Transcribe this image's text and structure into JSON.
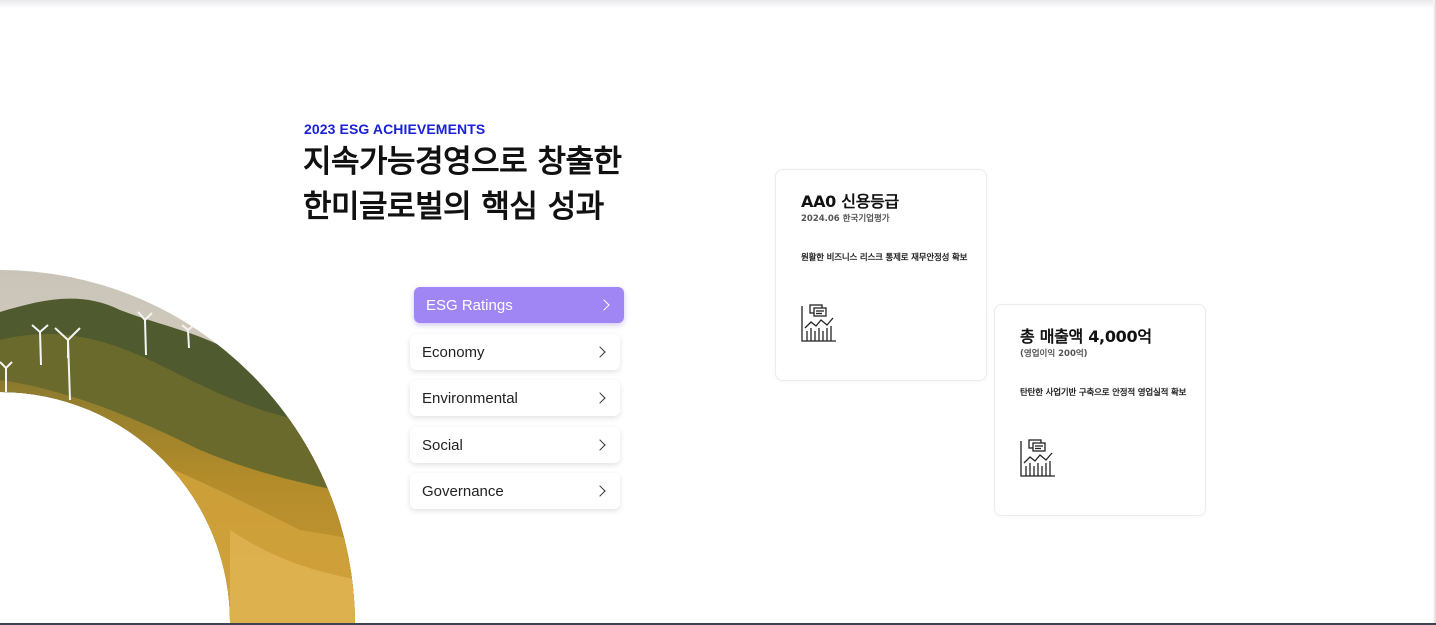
{
  "section": {
    "eyebrow": "2023 ESG ACHIEVEMENTS",
    "headline_line1": "지속가능경영으로 창출한",
    "headline_line2": "한미글로벌의 핵심 성과"
  },
  "menu": {
    "items": [
      {
        "label": "ESG Ratings",
        "active": true
      },
      {
        "label": "Economy",
        "active": false
      },
      {
        "label": "Environmental",
        "active": false
      },
      {
        "label": "Social",
        "active": false
      },
      {
        "label": "Governance",
        "active": false
      }
    ]
  },
  "cards": [
    {
      "title": "AA0 신용등급",
      "subtitle": "2024.06 한국기업평가",
      "description": "원활한 비즈니스 리스크 통제로 재무안정성 확보",
      "icon": "report-chart-icon"
    },
    {
      "title": "총 매출액 4,000억",
      "subtitle": "(영업이익 200억)",
      "description": "탄탄한 사업기반 구축으로 안정적 영업실적 확보",
      "icon": "report-chart-icon"
    }
  ],
  "colors": {
    "accent": "#1a21d6",
    "active_menu": "#a086f5"
  }
}
